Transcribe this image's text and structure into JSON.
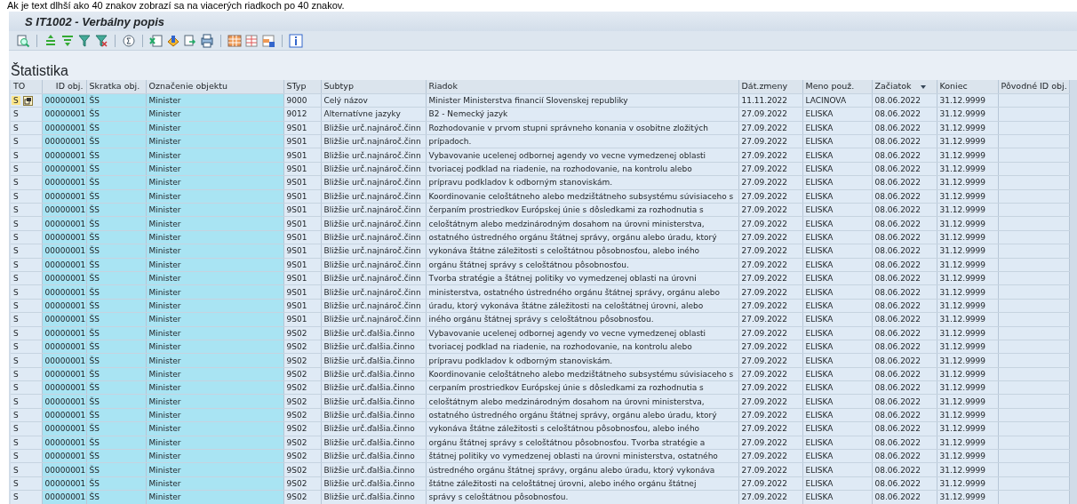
{
  "caption": "Ak je text dlhší ako 40 znakov zobrazí sa na viacerých riadkoch po 40 znakov.",
  "window": {
    "title": "S IT1002 - Verbálny popis"
  },
  "toolbar": {
    "groups": [
      {
        "buttons": [
          {
            "kind": "details"
          }
        ]
      },
      {
        "buttons": [
          {
            "kind": "sort-up"
          },
          {
            "kind": "sort-down"
          },
          {
            "kind": "filter"
          },
          {
            "kind": "filter-off"
          }
        ]
      },
      {
        "buttons": [
          {
            "kind": "total"
          }
        ]
      },
      {
        "buttons": [
          {
            "kind": "export"
          },
          {
            "kind": "word"
          },
          {
            "kind": "transfer"
          },
          {
            "kind": "print"
          }
        ]
      },
      {
        "buttons": [
          {
            "kind": "grid"
          },
          {
            "kind": "layout-change"
          },
          {
            "kind": "layout-select"
          }
        ]
      },
      {
        "buttons": [
          {
            "kind": "info"
          }
        ]
      }
    ]
  },
  "panel": {
    "title": "Štatistika"
  },
  "table": {
    "columns": [
      {
        "label": "TO",
        "kind": "plain",
        "sorted": false
      },
      {
        "label": "ID obj.",
        "kind": "key",
        "sorted": false
      },
      {
        "label": "Skratka obj.",
        "kind": "key",
        "sorted": false
      },
      {
        "label": "Označenie objektu",
        "kind": "key",
        "sorted": false
      },
      {
        "label": "STyp",
        "kind": "plain",
        "sorted": false
      },
      {
        "label": "Subtyp",
        "kind": "plain",
        "sorted": false
      },
      {
        "label": "Riadok",
        "kind": "plain",
        "sorted": false
      },
      {
        "label": "Dát.zmeny",
        "kind": "plain",
        "sorted": false
      },
      {
        "label": "Meno použ.",
        "kind": "plain",
        "sorted": false
      },
      {
        "label": "Začiatok",
        "kind": "plain",
        "sorted": true
      },
      {
        "label": "Koniec",
        "kind": "plain",
        "sorted": false
      },
      {
        "label": "Pôvodné ID obj.",
        "kind": "plain",
        "sorted": false
      }
    ],
    "rows": [
      {
        "focused": true,
        "cells": [
          "S",
          "00000001",
          "ŠS",
          "Minister",
          "9000",
          "Celý názov",
          "Minister Ministerstva financií Slovenskej republiky",
          "11.11.2022",
          "LACINOVA",
          "08.06.2022",
          "31.12.9999"
        ]
      },
      {
        "focused": false,
        "cells": [
          "S",
          "00000001",
          "ŠS",
          "Minister",
          "9012",
          "Alternatívne jazyky",
          "B2 - Nemecký jazyk",
          "27.09.2022",
          "ELISKA",
          "08.06.2022",
          "31.12.9999"
        ]
      },
      {
        "focused": false,
        "cells": [
          "S",
          "00000001",
          "ŠS",
          "Minister",
          "9S01",
          "Bližšie urč.najnároč.činn",
          "Rozhodovanie v prvom stupni správneho konania v osobitne zložitých",
          "27.09.2022",
          "ELISKA",
          "08.06.2022",
          "31.12.9999"
        ]
      },
      {
        "focused": false,
        "cells": [
          "S",
          "00000001",
          "ŠS",
          "Minister",
          "9S01",
          "Bližšie urč.najnároč.činn",
          "prípadoch.",
          "27.09.2022",
          "ELISKA",
          "08.06.2022",
          "31.12.9999"
        ]
      },
      {
        "focused": false,
        "cells": [
          "S",
          "00000001",
          "ŠS",
          "Minister",
          "9S01",
          "Bližšie urč.najnároč.činn",
          "Vybavovanie ucelenej odbornej agendy vo vecne vymedzenej oblasti",
          "27.09.2022",
          "ELISKA",
          "08.06.2022",
          "31.12.9999"
        ]
      },
      {
        "focused": false,
        "cells": [
          "S",
          "00000001",
          "ŠS",
          "Minister",
          "9S01",
          "Bližšie urč.najnároč.činn",
          "tvoriacej podklad na riadenie, na rozhodovanie, na kontrolu alebo",
          "27.09.2022",
          "ELISKA",
          "08.06.2022",
          "31.12.9999"
        ]
      },
      {
        "focused": false,
        "cells": [
          "S",
          "00000001",
          "ŠS",
          "Minister",
          "9S01",
          "Bližšie urč.najnároč.činn",
          "prípravu podkladov k odborným stanoviskám.",
          "27.09.2022",
          "ELISKA",
          "08.06.2022",
          "31.12.9999"
        ]
      },
      {
        "focused": false,
        "cells": [
          "S",
          "00000001",
          "ŠS",
          "Minister",
          "9S01",
          "Bližšie urč.najnároč.činn",
          "Koordinovanie celoštátneho alebo medzištátneho subsystému súvisiaceho s",
          "27.09.2022",
          "ELISKA",
          "08.06.2022",
          "31.12.9999"
        ]
      },
      {
        "focused": false,
        "cells": [
          "S",
          "00000001",
          "ŠS",
          "Minister",
          "9S01",
          "Bližšie urč.najnároč.činn",
          "čerpaním prostriedkov Európskej únie s dôsledkami za rozhodnutia s",
          "27.09.2022",
          "ELISKA",
          "08.06.2022",
          "31.12.9999"
        ]
      },
      {
        "focused": false,
        "cells": [
          "S",
          "00000001",
          "ŠS",
          "Minister",
          "9S01",
          "Bližšie urč.najnároč.činn",
          "celoštátnym alebo medzinárodným dosahom na úrovni ministerstva,",
          "27.09.2022",
          "ELISKA",
          "08.06.2022",
          "31.12.9999"
        ]
      },
      {
        "focused": false,
        "cells": [
          "S",
          "00000001",
          "ŠS",
          "Minister",
          "9S01",
          "Bližšie urč.najnároč.činn",
          "ostatného ústredného orgánu štátnej správy, orgánu alebo úradu, ktorý",
          "27.09.2022",
          "ELISKA",
          "08.06.2022",
          "31.12.9999"
        ]
      },
      {
        "focused": false,
        "cells": [
          "S",
          "00000001",
          "ŠS",
          "Minister",
          "9S01",
          "Bližšie urč.najnároč.činn",
          "vykonáva štátne záležitosti s celoštátnou pôsobnosťou, alebo iného",
          "27.09.2022",
          "ELISKA",
          "08.06.2022",
          "31.12.9999"
        ]
      },
      {
        "focused": false,
        "cells": [
          "S",
          "00000001",
          "ŠS",
          "Minister",
          "9S01",
          "Bližšie urč.najnároč.činn",
          "orgánu štátnej správy s celoštátnou pôsobnosťou.",
          "27.09.2022",
          "ELISKA",
          "08.06.2022",
          "31.12.9999"
        ]
      },
      {
        "focused": false,
        "cells": [
          "S",
          "00000001",
          "ŠS",
          "Minister",
          "9S01",
          "Bližšie urč.najnároč.činn",
          "Tvorba stratégie a štátnej politiky vo vymedzenej oblasti na úrovni",
          "27.09.2022",
          "ELISKA",
          "08.06.2022",
          "31.12.9999"
        ]
      },
      {
        "focused": false,
        "cells": [
          "S",
          "00000001",
          "ŠS",
          "Minister",
          "9S01",
          "Bližšie urč.najnároč.činn",
          "ministerstva, ostatného ústredného orgánu štátnej správy, orgánu alebo",
          "27.09.2022",
          "ELISKA",
          "08.06.2022",
          "31.12.9999"
        ]
      },
      {
        "focused": false,
        "cells": [
          "S",
          "00000001",
          "ŠS",
          "Minister",
          "9S01",
          "Bližšie urč.najnároč.činn",
          "úradu, ktorý vykonáva štátne záležitosti na celoštátnej úrovni, alebo",
          "27.09.2022",
          "ELISKA",
          "08.06.2022",
          "31.12.9999"
        ]
      },
      {
        "focused": false,
        "cells": [
          "S",
          "00000001",
          "ŠS",
          "Minister",
          "9S01",
          "Bližšie urč.najnároč.činn",
          "iného orgánu štátnej správy s celoštátnou pôsobnosťou.",
          "27.09.2022",
          "ELISKA",
          "08.06.2022",
          "31.12.9999"
        ]
      },
      {
        "focused": false,
        "cells": [
          "S",
          "00000001",
          "ŠS",
          "Minister",
          "9S02",
          "Bližšie urč.ďalšia.činno",
          "Vybavovanie ucelenej odbornej agendy vo vecne vymedzenej oblasti",
          "27.09.2022",
          "ELISKA",
          "08.06.2022",
          "31.12.9999"
        ]
      },
      {
        "focused": false,
        "cells": [
          "S",
          "00000001",
          "ŠS",
          "Minister",
          "9S02",
          "Bližšie urč.ďalšia.činno",
          "tvoriacej podklad na riadenie, na rozhodovanie, na kontrolu alebo",
          "27.09.2022",
          "ELISKA",
          "08.06.2022",
          "31.12.9999"
        ]
      },
      {
        "focused": false,
        "cells": [
          "S",
          "00000001",
          "ŠS",
          "Minister",
          "9S02",
          "Bližšie urč.ďalšia.činno",
          "prípravu podkladov k odborným stanoviskám.",
          "27.09.2022",
          "ELISKA",
          "08.06.2022",
          "31.12.9999"
        ]
      },
      {
        "focused": false,
        "cells": [
          "S",
          "00000001",
          "ŠS",
          "Minister",
          "9S02",
          "Bližšie urč.ďalšia.činno",
          "Koordinovanie celoštátneho alebo medzištátneho subsystému súvisiaceho s",
          "27.09.2022",
          "ELISKA",
          "08.06.2022",
          "31.12.9999"
        ]
      },
      {
        "focused": false,
        "cells": [
          "S",
          "00000001",
          "ŠS",
          "Minister",
          "9S02",
          "Bližšie urč.ďalšia.činno",
          "cerpaním prostriedkov Európskej únie s dôsledkami za rozhodnutia s",
          "27.09.2022",
          "ELISKA",
          "08.06.2022",
          "31.12.9999"
        ]
      },
      {
        "focused": false,
        "cells": [
          "S",
          "00000001",
          "ŠS",
          "Minister",
          "9S02",
          "Bližšie urč.ďalšia.činno",
          "celoštátnym alebo medzinárodným dosahom na úrovni ministerstva,",
          "27.09.2022",
          "ELISKA",
          "08.06.2022",
          "31.12.9999"
        ]
      },
      {
        "focused": false,
        "cells": [
          "S",
          "00000001",
          "ŠS",
          "Minister",
          "9S02",
          "Bližšie urč.ďalšia.činno",
          "ostatného ústredného orgánu štátnej správy, orgánu alebo úradu, ktorý",
          "27.09.2022",
          "ELISKA",
          "08.06.2022",
          "31.12.9999"
        ]
      },
      {
        "focused": false,
        "cells": [
          "S",
          "00000001",
          "ŠS",
          "Minister",
          "9S02",
          "Bližšie urč.ďalšia.činno",
          "vykonáva štátne záležitosti s celoštátnou pôsobnosťou, alebo iného",
          "27.09.2022",
          "ELISKA",
          "08.06.2022",
          "31.12.9999"
        ]
      },
      {
        "focused": false,
        "cells": [
          "S",
          "00000001",
          "ŠS",
          "Minister",
          "9S02",
          "Bližšie urč.ďalšia.činno",
          "orgánu štátnej správy s celoštátnou pôsobnosťou. Tvorba stratégie a",
          "27.09.2022",
          "ELISKA",
          "08.06.2022",
          "31.12.9999"
        ]
      },
      {
        "focused": false,
        "cells": [
          "S",
          "00000001",
          "ŠS",
          "Minister",
          "9S02",
          "Bližšie urč.ďalšia.činno",
          "štátnej politiky vo vymedzenej oblasti na úrovni ministerstva, ostatného",
          "27.09.2022",
          "ELISKA",
          "08.06.2022",
          "31.12.9999"
        ]
      },
      {
        "focused": false,
        "cells": [
          "S",
          "00000001",
          "ŠS",
          "Minister",
          "9S02",
          "Bližšie urč.ďalšia.činno",
          "ústredného orgánu štátnej správy, orgánu alebo úradu, ktorý vykonáva",
          "27.09.2022",
          "ELISKA",
          "08.06.2022",
          "31.12.9999"
        ]
      },
      {
        "focused": false,
        "cells": [
          "S",
          "00000001",
          "ŠS",
          "Minister",
          "9S02",
          "Bližšie urč.ďalšia.činno",
          "štátne záležitosti na celoštátnej úrovni, alebo iného orgánu štátnej",
          "27.09.2022",
          "ELISKA",
          "08.06.2022",
          "31.12.9999"
        ]
      },
      {
        "focused": false,
        "cells": [
          "S",
          "00000001",
          "ŠS",
          "Minister",
          "9S02",
          "Bližšie urč.ďalšia.činno",
          "správy s celoštátnou pôsobnosťou.",
          "27.09.2022",
          "ELISKA",
          "08.06.2022",
          "31.12.9999"
        ]
      }
    ]
  }
}
